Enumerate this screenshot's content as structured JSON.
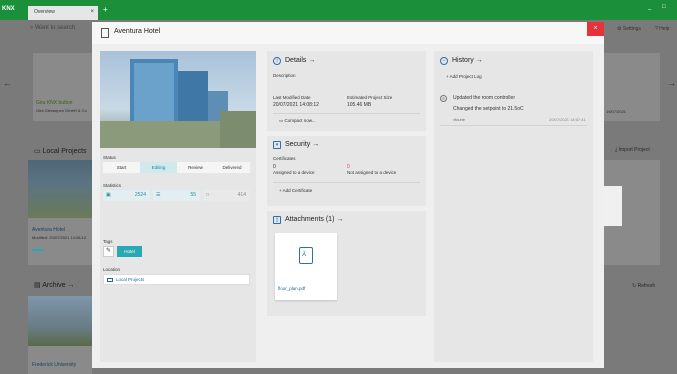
{
  "app": {
    "logo": "KNX",
    "tab_label": "Overview",
    "tab_close": "×",
    "new_tab": "+",
    "minimize": "_",
    "maximize": "□"
  },
  "background": {
    "search_placeholder": "Want to search",
    "settings": "Settings",
    "help": "Help",
    "left_card_title": "Gira KNX button",
    "left_card_sub": "Gira Giersiepen GmbH & Co",
    "date_right": "19/07/2021",
    "local_projects": "Local Projects",
    "import_project": "Import Project",
    "aventura_title": "Aventura Hotel",
    "aventura_sub": "Modified: 20/07/2021 14:08:12",
    "archive": "Archive →",
    "refresh": "Refresh",
    "frederick": "Frederick University"
  },
  "modal": {
    "title": "Aventura Hotel",
    "close": "×",
    "status": {
      "label": "Status",
      "stages": [
        "Start",
        "Editing",
        "Review",
        "Delivered"
      ],
      "active": 1
    },
    "statistics": {
      "label": "Statistics",
      "items": [
        "2524",
        "55",
        "414"
      ]
    },
    "tags": {
      "label": "Tags",
      "tag": "Hotel"
    },
    "location": {
      "label": "Location",
      "value": "Local Projects"
    },
    "details": {
      "title": "Details →",
      "description_label": "Description",
      "last_modified_label": "Last Modified Date",
      "last_modified_value": "20/07/2021 14:08:12",
      "size_label": "Estimated Project Size",
      "size_value": "105.46 MB",
      "compact_button": "Compact now..."
    },
    "security": {
      "title": "Security →",
      "certificates_label": "Certificates",
      "assigned_count": "0",
      "assigned_label": "Assigned to a device",
      "not_assigned_count": "0",
      "not_assigned_label": "Not assigned to a device",
      "add_button": "+  Add Certificate"
    },
    "attachments": {
      "title": "Attachments (1) →",
      "file": "floor_plan.pdf"
    },
    "history": {
      "title": "History →",
      "add_log": "+  Add Project Log",
      "entry_title": "Updated the room controller",
      "entry_text": "Changed the setpoint to 21.5oC",
      "entry_user": "vfourie",
      "entry_date": "20/07/2021 14:07:41"
    }
  }
}
